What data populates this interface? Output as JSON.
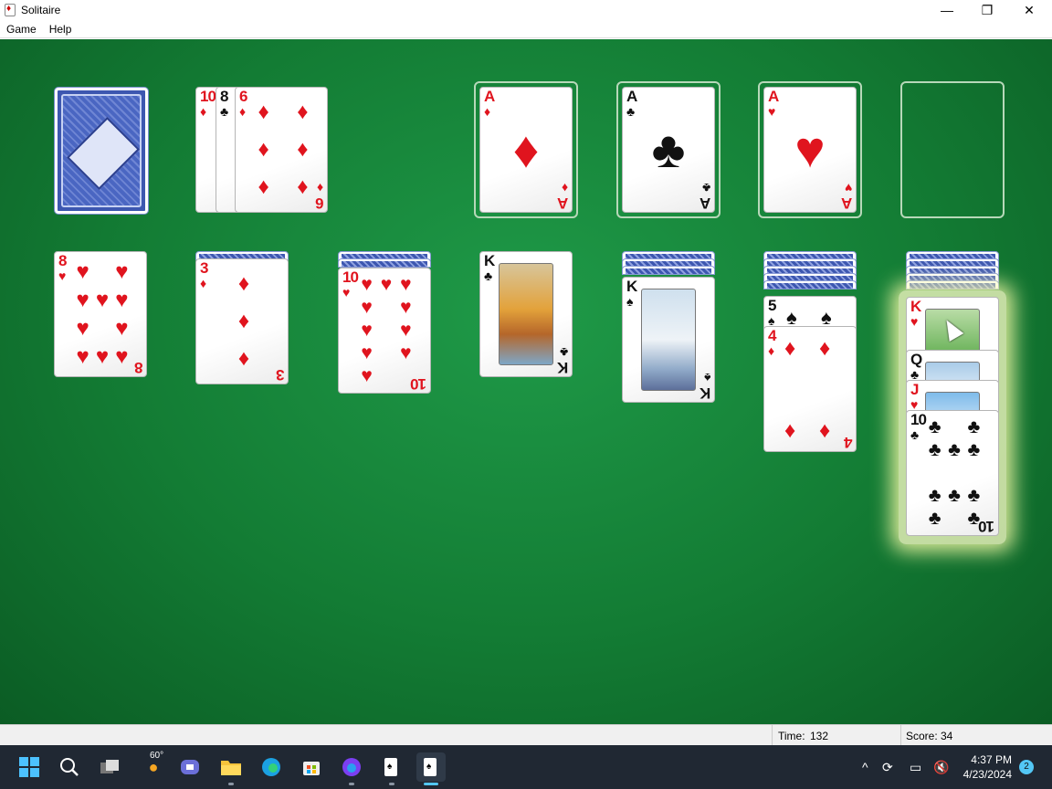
{
  "window": {
    "title": "Solitaire",
    "minimize": "—",
    "restore": "❐",
    "close": "✕"
  },
  "menu": {
    "game": "Game",
    "help": "Help"
  },
  "waste": [
    {
      "rank": "10",
      "suit": "♦",
      "color": "red"
    },
    {
      "rank": "8",
      "suit": "♣",
      "color": "blk"
    },
    {
      "rank": "6",
      "suit": "♦",
      "color": "red"
    }
  ],
  "foundations": [
    {
      "rank": "A",
      "suit": "♦",
      "color": "red"
    },
    {
      "rank": "A",
      "suit": "♣",
      "color": "blk"
    },
    {
      "rank": "A",
      "suit": "♥",
      "color": "red"
    },
    {
      "rank": "",
      "suit": "",
      "color": ""
    }
  ],
  "tableau": [
    {
      "hidden": 0,
      "cards": [
        {
          "rank": "8",
          "suit": "♥",
          "color": "red"
        }
      ]
    },
    {
      "hidden": 1,
      "cards": [
        {
          "rank": "3",
          "suit": "♦",
          "color": "red"
        }
      ]
    },
    {
      "hidden": 2,
      "cards": [
        {
          "rank": "10",
          "suit": "♥",
          "color": "red"
        }
      ]
    },
    {
      "hidden": 0,
      "cards": [
        {
          "rank": "K",
          "suit": "♣",
          "color": "blk"
        }
      ]
    },
    {
      "hidden": 3,
      "cards": [
        {
          "rank": "K",
          "suit": "♠",
          "color": "blk"
        }
      ]
    },
    {
      "hidden": 5,
      "cards": [
        {
          "rank": "5",
          "suit": "♠",
          "color": "blk"
        },
        {
          "rank": "4",
          "suit": "♦",
          "color": "red"
        }
      ]
    },
    {
      "hidden": 5,
      "cards": [
        {
          "rank": "K",
          "suit": "♥",
          "color": "red"
        },
        {
          "rank": "Q",
          "suit": "♣",
          "color": "blk"
        },
        {
          "rank": "J",
          "suit": "♥",
          "color": "red"
        },
        {
          "rank": "10",
          "suit": "♣",
          "color": "blk"
        }
      ]
    }
  ],
  "status": {
    "time_label": "Time:",
    "time": "132",
    "score_label": "Score:",
    "score": "34"
  },
  "taskbar": {
    "weather_temp": "60°",
    "time": "4:37 PM",
    "date": "4/23/2024",
    "notifications": "2"
  }
}
